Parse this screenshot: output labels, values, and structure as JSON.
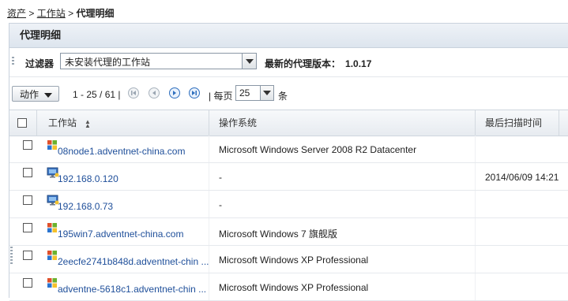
{
  "breadcrumb": {
    "item1": "资产",
    "sep1": ">",
    "item2": "工作站",
    "sep2": ">",
    "current": "代理明细"
  },
  "panel": {
    "title": "代理明细"
  },
  "filter": {
    "label": "过滤器",
    "selected": "未安装代理的工作站",
    "version_label": "最新的代理版本：",
    "version_value": "1.0.17"
  },
  "toolbar": {
    "action_label": "动作",
    "range": "1 - 25 / 61 |",
    "per_page_label": "| 每页",
    "per_page_value": "25",
    "unit": "条"
  },
  "table": {
    "headers": {
      "workstation": "工作站",
      "os": "操作系统",
      "last_scan": "最后扫描时间"
    },
    "rows": [
      {
        "name": "08node1.adventnet-china.com",
        "os": "Microsoft Windows Server 2008 R2 Datacenter",
        "time": "",
        "icon": "windows-flag-icon"
      },
      {
        "name": "192.168.0.120",
        "os": "-",
        "time": "2014/06/09 14:21",
        "icon": "monitor-icon"
      },
      {
        "name": "192.168.0.73",
        "os": "-",
        "time": "",
        "icon": "monitor-icon"
      },
      {
        "name": "195win7.adventnet-china.com",
        "os": "Microsoft Windows 7 旗舰版",
        "time": "",
        "icon": "windows-flag-icon"
      },
      {
        "name": "2eecfe2741b848d.adventnet-chin ...",
        "os": "Microsoft Windows XP Professional",
        "time": "",
        "icon": "windows-flag-icon"
      },
      {
        "name": "adventne-5618c1.adventnet-chin ...",
        "os": "Microsoft Windows XP Professional",
        "time": "",
        "icon": "windows-flag-icon"
      }
    ]
  },
  "colors": {
    "link": "#1f4f9a",
    "header_bg": "#e7ebf0"
  }
}
